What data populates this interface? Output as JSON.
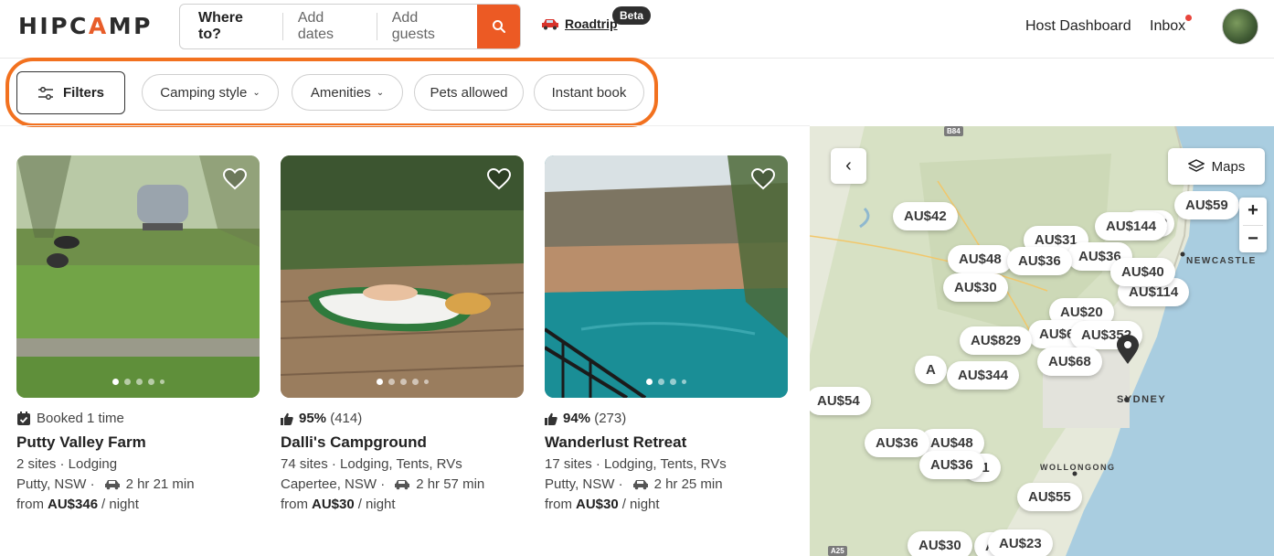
{
  "header": {
    "logo_pre": "HIPC",
    "logo_a": "A",
    "logo_post": "MP",
    "search": {
      "where": "Where to?",
      "dates": "Add dates",
      "guests": "Add guests"
    },
    "roadtrip": "Roadtrip",
    "beta": "Beta",
    "host_dashboard": "Host Dashboard",
    "inbox": "Inbox"
  },
  "filters": {
    "filters_label": "Filters",
    "camping_style": "Camping style",
    "amenities": "Amenities",
    "pets": "Pets allowed",
    "instant": "Instant book"
  },
  "listings": [
    {
      "meta_text": "Booked 1 time",
      "title": "Putty Valley Farm",
      "sites": "2 sites · Lodging",
      "location": "Putty, NSW ·",
      "drive": "2 hr 21 min",
      "from": "from",
      "price": "AU$346",
      "per": "/ night"
    },
    {
      "rating": "95%",
      "reviews": "(414)",
      "title": "Dalli's Campground",
      "sites": "74 sites · Lodging, Tents, RVs",
      "location": "Capertee, NSW ·",
      "drive": "2 hr 57 min",
      "from": "from",
      "price": "AU$30",
      "per": "/ night"
    },
    {
      "rating": "94%",
      "reviews": "(273)",
      "title": "Wanderlust Retreat",
      "sites": "17 sites · Lodging, Tents, RVs",
      "location": "Putty, NSW ·",
      "drive": "2 hr 25 min",
      "from": "from",
      "price": "AU$30",
      "per": "/ night"
    }
  ],
  "map": {
    "maps_label": "Maps",
    "zoom_in": "+",
    "zoom_out": "−",
    "cities": [
      "NEWCASTLE",
      "SYDNEY",
      "WOLLONGONG"
    ],
    "roads": [
      "B84",
      "A25"
    ],
    "prices": [
      "AU$42",
      "AU$144",
      "AU$59",
      "AU$31",
      "AU$48",
      "AU$36",
      "AU$36",
      "AU$40",
      "AU$30",
      "AU$2",
      "AU$114",
      "AU$20",
      "AU$829",
      "AU$67",
      "AU$352",
      "AU$68",
      "A",
      "AU$344",
      "AU$54",
      "AU$36",
      "AU$48",
      "AU$36",
      "61",
      "AU$55",
      "AU$30",
      "AU$23",
      "AU"
    ]
  }
}
